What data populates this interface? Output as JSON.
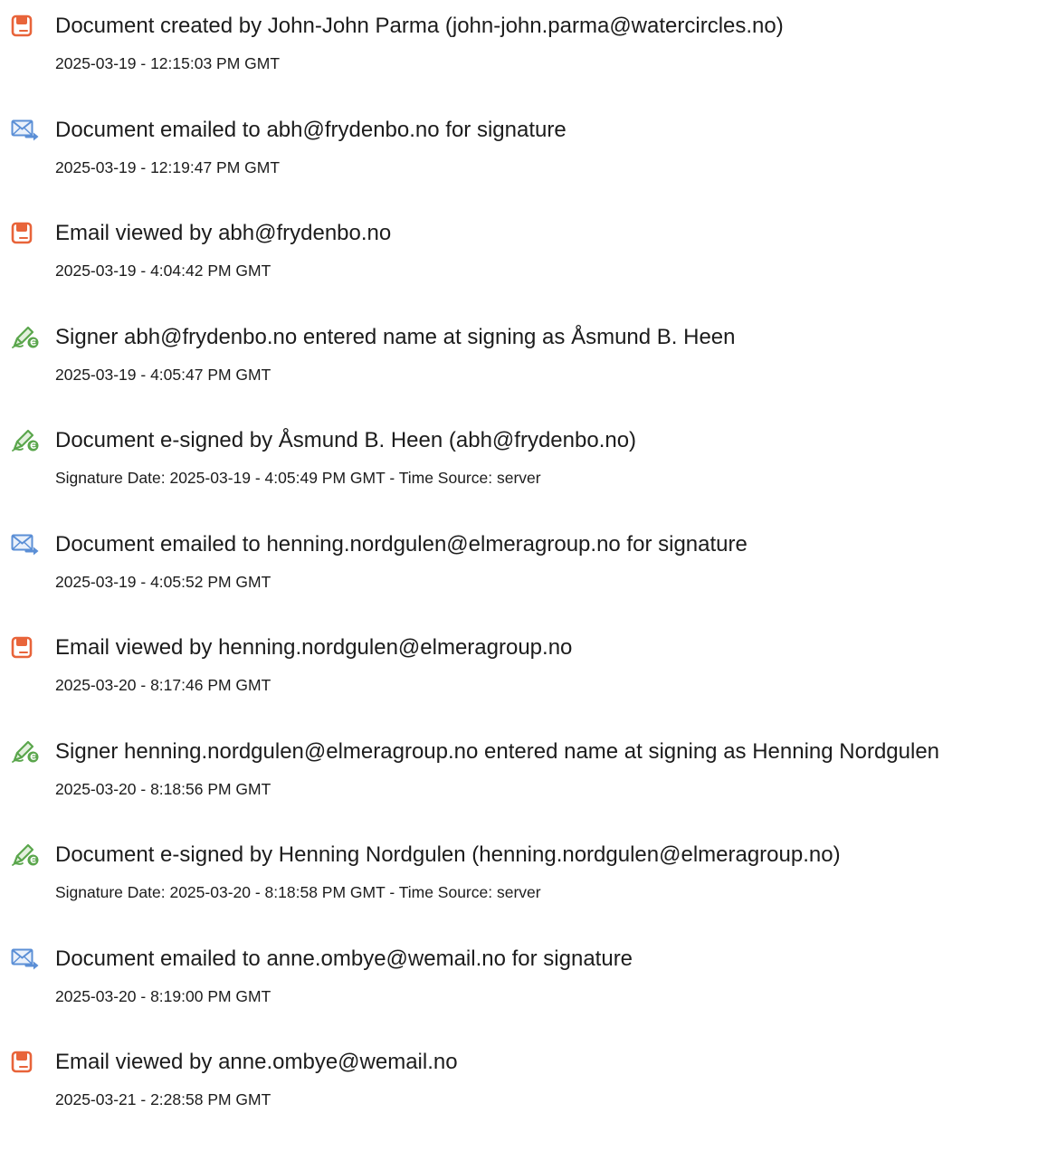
{
  "icons": {
    "document": {
      "name": "document-created-icon",
      "color": "#e8643a"
    },
    "email": {
      "name": "email-sent-icon",
      "color": "#5b8fd6"
    },
    "sign": {
      "name": "e-sign-pen-icon",
      "color": "#5aa64c"
    }
  },
  "events": [
    {
      "icon": "document",
      "title": "Document created by John-John Parma (john-john.parma@watercircles.no)",
      "timestamp": "2025-03-19 - 12:15:03 PM GMT"
    },
    {
      "icon": "email",
      "title": "Document emailed to abh@frydenbo.no for signature",
      "timestamp": "2025-03-19 - 12:19:47 PM GMT"
    },
    {
      "icon": "document",
      "title": "Email viewed by abh@frydenbo.no",
      "timestamp": "2025-03-19 - 4:04:42 PM GMT"
    },
    {
      "icon": "sign",
      "title": "Signer abh@frydenbo.no entered name at signing as Åsmund B. Heen",
      "timestamp": "2025-03-19 - 4:05:47 PM GMT"
    },
    {
      "icon": "sign",
      "title": "Document e-signed by Åsmund B. Heen (abh@frydenbo.no)",
      "timestamp": "Signature Date: 2025-03-19 - 4:05:49 PM GMT - Time Source: server"
    },
    {
      "icon": "email",
      "title": "Document emailed to henning.nordgulen@elmeragroup.no for signature",
      "timestamp": "2025-03-19 - 4:05:52 PM GMT"
    },
    {
      "icon": "document",
      "title": "Email viewed by henning.nordgulen@elmeragroup.no",
      "timestamp": "2025-03-20 - 8:17:46 PM GMT"
    },
    {
      "icon": "sign",
      "title": "Signer henning.nordgulen@elmeragroup.no entered name at signing as Henning Nordgulen",
      "timestamp": "2025-03-20 - 8:18:56 PM GMT"
    },
    {
      "icon": "sign",
      "title": "Document e-signed by Henning Nordgulen (henning.nordgulen@elmeragroup.no)",
      "timestamp": "Signature Date: 2025-03-20 - 8:18:58 PM GMT - Time Source: server"
    },
    {
      "icon": "email",
      "title": "Document emailed to anne.ombye@wemail.no for signature",
      "timestamp": "2025-03-20 - 8:19:00 PM GMT"
    },
    {
      "icon": "document",
      "title": "Email viewed by anne.ombye@wemail.no",
      "timestamp": "2025-03-21 - 2:28:58 PM GMT"
    }
  ]
}
